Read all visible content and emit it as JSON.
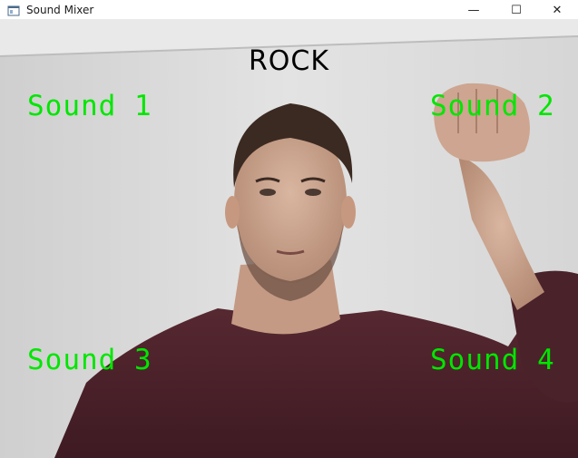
{
  "window": {
    "title": "Sound Mixer",
    "icon": "window-app-icon",
    "controls": {
      "minimize": "—",
      "maximize": "☐",
      "close": "✕"
    }
  },
  "overlay": {
    "gesture": "ROCK",
    "sounds": [
      "Sound 1",
      "Sound 2",
      "Sound 3",
      "Sound 4"
    ],
    "sound_color": "#00e600",
    "gesture_color": "#000000"
  }
}
